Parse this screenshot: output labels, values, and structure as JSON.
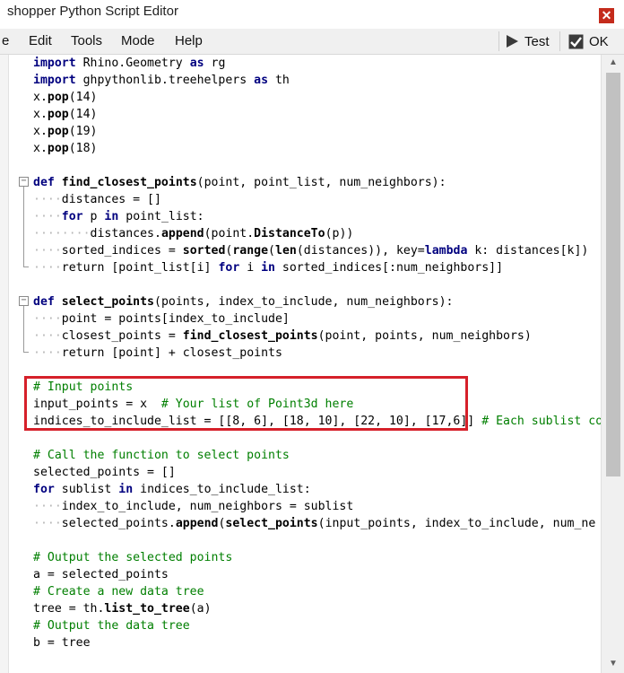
{
  "window": {
    "title": "shopper Python Script Editor",
    "close_symbol": "✕"
  },
  "menu": {
    "items": [
      "e",
      "Edit",
      "Tools",
      "Mode",
      "Help"
    ],
    "test_label": "Test",
    "ok_label": "OK"
  },
  "code": {
    "lines": [
      "import Rhino.Geometry as rg",
      "import ghpythonlib.treehelpers as th",
      "x.pop(14)",
      "x.pop(14)",
      "x.pop(19)",
      "x.pop(18)",
      "",
      "def find_closest_points(point, point_list, num_neighbors):",
      "····distances = []",
      "····for p in point_list:",
      "········distances.append(point.DistanceTo(p))",
      "····sorted_indices = sorted(range(len(distances)), key=lambda k: distances[k])",
      "····return [point_list[i] for i in sorted_indices[:num_neighbors]]",
      "",
      "def select_points(points, index_to_include, num_neighbors):",
      "····point = points[index_to_include]",
      "····closest_points = find_closest_points(point, points, num_neighbors)",
      "····return [point] + closest_points",
      "",
      "# Input points",
      "input_points = x  # Your list of Point3d here",
      "indices_to_include_list = [[8, 6], [18, 10], [22, 10], [17,6]] # Each sublist co",
      "",
      "# Call the function to select points",
      "selected_points = []",
      "for sublist in indices_to_include_list:",
      "····index_to_include, num_neighbors = sublist",
      "····selected_points.append(select_points(input_points, index_to_include, num_ne",
      "",
      "# Output the selected points",
      "a = selected_points",
      "# Create a new data tree",
      "tree = th.list_to_tree(a)",
      "# Output the data tree",
      "b = tree"
    ]
  },
  "colors": {
    "keyword": "#00007f",
    "comment": "#007f00",
    "highlight_border": "#d6202a"
  }
}
